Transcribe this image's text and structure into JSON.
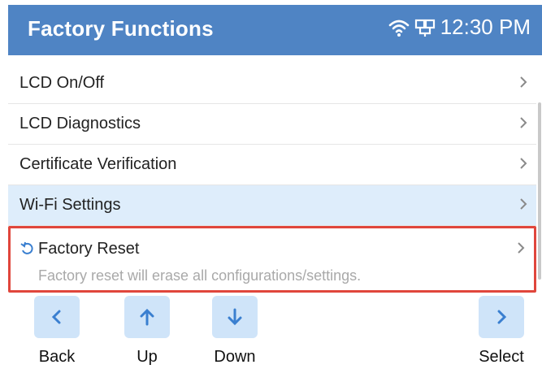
{
  "header": {
    "title": "Factory Functions",
    "time": "12:30 PM",
    "bg_color": "#4f84c4",
    "icons": [
      "wifi-icon",
      "network-icon"
    ]
  },
  "menu": {
    "items": [
      {
        "label": "LCD On/Off"
      },
      {
        "label": "LCD Diagnostics"
      },
      {
        "label": "Certificate Verification"
      },
      {
        "label": "Wi-Fi Settings",
        "selected": true
      },
      {
        "label": "Factory Reset",
        "description": "Factory reset will erase all configurations/settings.",
        "highlighted": true
      }
    ],
    "selected_color": "#deedfb",
    "highlight_border_color": "#e0463c"
  },
  "softkeys": {
    "back": "Back",
    "up": "Up",
    "down": "Down",
    "select": "Select",
    "button_color": "#cfe4f9",
    "icon_color": "#3a7fd0"
  }
}
